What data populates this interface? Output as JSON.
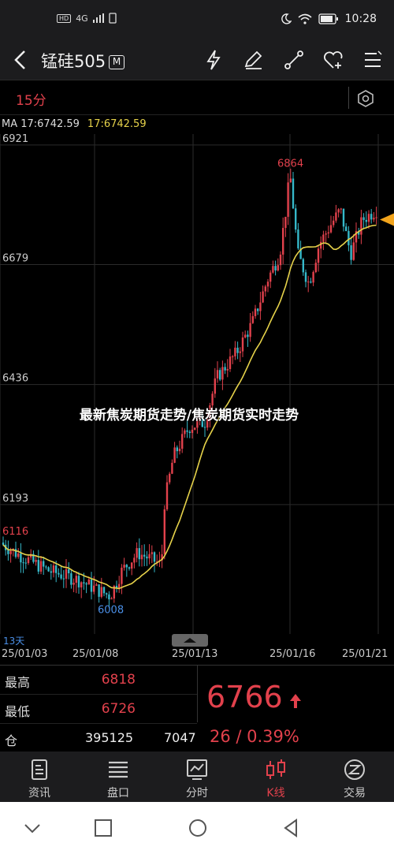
{
  "status": {
    "network": "4G",
    "time": "10:28"
  },
  "header": {
    "title": "锰硅505",
    "badge": "M"
  },
  "period": {
    "label": "15分"
  },
  "ma": {
    "label": "MA 17:6742.59",
    "value": "17:6742.59"
  },
  "overlay": {
    "title": "最新焦炭期货走势/焦炭期货实时走势"
  },
  "chart_data": {
    "type": "candlestick",
    "y_ticks": [
      "6921",
      "6679",
      "6436",
      "6193"
    ],
    "y_lim": [
      5950,
      6940
    ],
    "high_label": "6864",
    "low_label": "6008",
    "left_label": "6116",
    "x_labels": [
      "25/01/03",
      "25/01/08",
      "25/01/13",
      "25/01/16",
      "25/01/21"
    ],
    "days_label": "13天",
    "colors": {
      "up": "#e2414c",
      "down": "#35b8c9",
      "ma": "#e6d24a",
      "grid": "#2b2b2b"
    }
  },
  "info": {
    "high_label": "最高",
    "high_value": "6818",
    "low_label": "最低",
    "low_value": "6726",
    "oi_label": "仓",
    "oi_value": "395125",
    "oi_change": "7047",
    "last_price": "6766",
    "change": "26 / 0.39%"
  },
  "tabs": [
    {
      "label": "资讯",
      "icon": "news-icon"
    },
    {
      "label": "盘口",
      "icon": "orderbook-icon"
    },
    {
      "label": "分时",
      "icon": "timeshare-icon"
    },
    {
      "label": "K线",
      "icon": "kline-icon"
    },
    {
      "label": "交易",
      "icon": "trade-icon"
    }
  ]
}
